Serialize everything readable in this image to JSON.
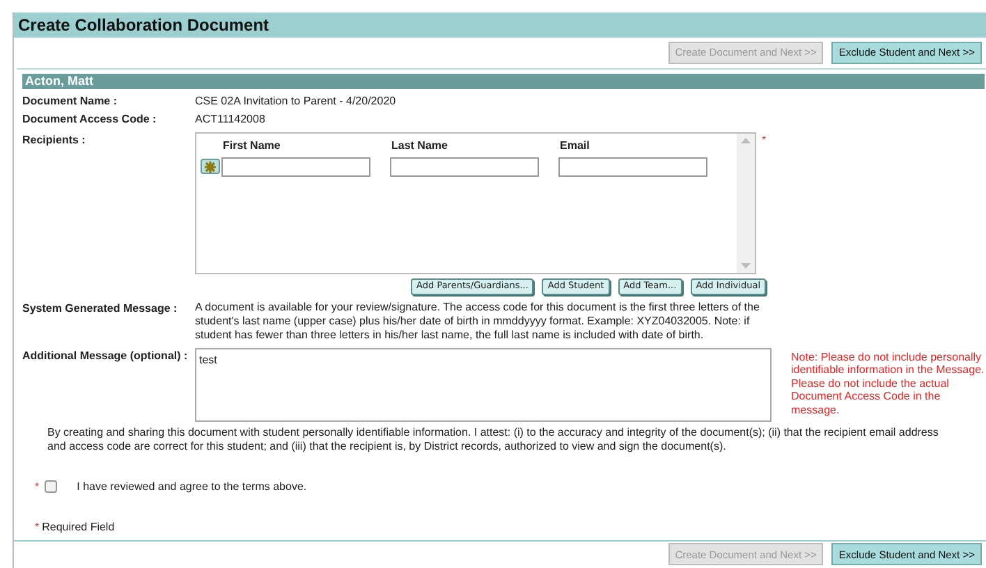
{
  "page": {
    "title": "Create Collaboration Document"
  },
  "actions_top": [
    {
      "label": "Create Document and Next >>",
      "disabled": true
    },
    {
      "label": "Exclude Student and Next >>",
      "disabled": false
    }
  ],
  "student": {
    "name": "Acton, Matt"
  },
  "fields": [
    {
      "label": "Document Name :",
      "value": "CSE 02A Invitation to Parent - 4/20/2020"
    },
    {
      "label": "Document Access Code :",
      "value": "ACT11142008"
    }
  ],
  "recipients": {
    "label": "Recipients :",
    "required_mark": "*",
    "columns": [
      "First Name",
      "Last Name",
      "Email"
    ],
    "add_buttons": [
      "Add Parents/Guardians...",
      "Add Student",
      "Add Team...",
      "Add Individual"
    ]
  },
  "system_message": {
    "label": "System Generated Message :",
    "text": "A document is available for your review/signature. The access code for this document is the first three letters of the student's last name (upper case) plus his/her date of birth in mmddyyyy format. Example: XYZ04032005. Note: if student has fewer than three letters in his/her last name, the full last name is included with date of birth."
  },
  "additional_message": {
    "label": "Additional Message (optional) :",
    "value": "test",
    "note": "Note: Please do not include personally identifiable information in the Message. Please do not include the actual Document Access Code in the message."
  },
  "attestation": "By creating and sharing this document with student personally identifiable information. I attest: (i) to the accuracy and integrity of the document(s); (ii) that the recipient email address and access code are correct for this student; and (iii) that the recipient is, by District records, authorized to view and sign the document(s).",
  "agreement": {
    "required_mark": "*",
    "label": "I have reviewed and agree to the terms above.",
    "checked": false
  },
  "required_note": {
    "mark": "*",
    "text": "Required Field"
  },
  "actions_bottom": [
    {
      "label": "Create Document and Next >>",
      "disabled": true
    },
    {
      "label": "Exclude Student and Next >>",
      "disabled": false
    }
  ]
}
